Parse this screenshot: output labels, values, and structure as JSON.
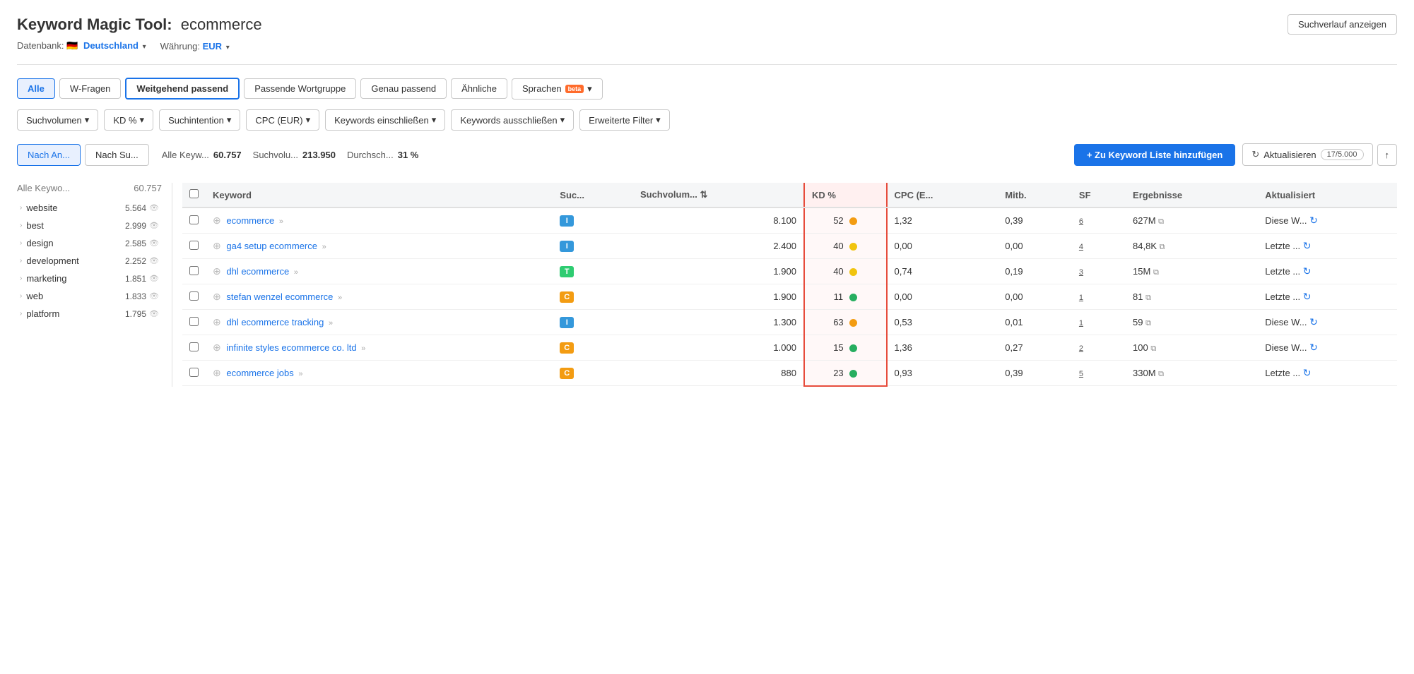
{
  "header": {
    "title_bold": "Keyword Magic Tool:",
    "title_query": "ecommerce",
    "suchverlauf_btn": "Suchverlauf anzeigen",
    "datenbank_label": "Datenbank:",
    "country": "Deutschland",
    "wahrung_label": "Währung:",
    "currency": "EUR"
  },
  "tabs": [
    {
      "id": "alle",
      "label": "Alle",
      "active": true,
      "highlighted": false
    },
    {
      "id": "w-fragen",
      "label": "W-Fragen",
      "active": false,
      "highlighted": false
    },
    {
      "id": "weitgehend",
      "label": "Weitgehend passend",
      "active": false,
      "highlighted": true
    },
    {
      "id": "passende",
      "label": "Passende Wortgruppe",
      "active": false,
      "highlighted": false
    },
    {
      "id": "genau",
      "label": "Genau passend",
      "active": false,
      "highlighted": false
    },
    {
      "id": "ahnliche",
      "label": "Ähnliche",
      "active": false,
      "highlighted": false
    },
    {
      "id": "sprachen",
      "label": "Sprachen",
      "active": false,
      "highlighted": false,
      "beta": true
    }
  ],
  "filters": [
    {
      "id": "suchvolumen",
      "label": "Suchvolumen ▾"
    },
    {
      "id": "kd",
      "label": "KD % ▾"
    },
    {
      "id": "suchintention",
      "label": "Suchintention ▾"
    },
    {
      "id": "cpc",
      "label": "CPC (EUR) ▾"
    },
    {
      "id": "einschliessen",
      "label": "Keywords einschließen ▾"
    },
    {
      "id": "ausschliessen",
      "label": "Keywords ausschließen ▾"
    },
    {
      "id": "erweitert",
      "label": "Erweiterte Filter ▾"
    }
  ],
  "stats": {
    "sort_by_an": "Nach An...",
    "sort_by_su": "Nach Su...",
    "alle_keywords_label": "Alle Keyw...",
    "alle_keywords_value": "60.757",
    "suchvolumen_label": "Suchvolu...",
    "suchvolumen_value": "213.950",
    "durchschnitt_label": "Durchsch...",
    "durchschnitt_value": "31 %",
    "add_btn": "+ Zu Keyword Liste hinzufügen",
    "aktualisieren_btn": "Aktualisieren",
    "limit": "17/5.000"
  },
  "left_panel": {
    "title": "Alle Keywo...",
    "count": "60.757",
    "items": [
      {
        "name": "website",
        "count": "5.564"
      },
      {
        "name": "best",
        "count": "2.999"
      },
      {
        "name": "design",
        "count": "2.585"
      },
      {
        "name": "development",
        "count": "2.252"
      },
      {
        "name": "marketing",
        "count": "1.851"
      },
      {
        "name": "web",
        "count": "1.833"
      },
      {
        "name": "platform",
        "count": "1.795"
      }
    ]
  },
  "table": {
    "columns": [
      {
        "id": "keyword",
        "label": "Keyword"
      },
      {
        "id": "suc",
        "label": "Suc..."
      },
      {
        "id": "suchvolumen",
        "label": "Suchvolum..."
      },
      {
        "id": "kd",
        "label": "KD %",
        "sorted": true
      },
      {
        "id": "cpc",
        "label": "CPC (E..."
      },
      {
        "id": "mitb",
        "label": "Mitb."
      },
      {
        "id": "sf",
        "label": "SF"
      },
      {
        "id": "ergebnisse",
        "label": "Ergebnisse"
      },
      {
        "id": "aktualisiert",
        "label": "Aktualisiert"
      }
    ],
    "rows": [
      {
        "keyword": "ecommerce",
        "arrows": "»",
        "intent": "I",
        "intent_type": "i",
        "suchvolumen": "8.100",
        "kd": "52",
        "kd_color": "orange",
        "cpc": "1,32",
        "mitb": "0,39",
        "sf": "6",
        "ergebnisse": "627M",
        "aktualisiert": "Diese W..."
      },
      {
        "keyword": "ga4 setup ecommerce",
        "arrows": "»",
        "intent": "I",
        "intent_type": "i",
        "suchvolumen": "2.400",
        "kd": "40",
        "kd_color": "yellow",
        "cpc": "0,00",
        "mitb": "0,00",
        "sf": "4",
        "ergebnisse": "84,8K",
        "aktualisiert": "Letzte ..."
      },
      {
        "keyword": "dhl ecommerce",
        "arrows": "»",
        "intent": "T",
        "intent_type": "t",
        "suchvolumen": "1.900",
        "kd": "40",
        "kd_color": "yellow",
        "cpc": "0,74",
        "mitb": "0,19",
        "sf": "3",
        "ergebnisse": "15M",
        "aktualisiert": "Letzte ..."
      },
      {
        "keyword": "stefan wenzel ecommerce",
        "arrows": "»",
        "intent": "C",
        "intent_type": "c",
        "suchvolumen": "1.900",
        "kd": "11",
        "kd_color": "green",
        "cpc": "0,00",
        "mitb": "0,00",
        "sf": "1",
        "ergebnisse": "81",
        "aktualisiert": "Letzte ..."
      },
      {
        "keyword": "dhl ecommerce tracking",
        "arrows": "»",
        "intent": "I",
        "intent_type": "i",
        "suchvolumen": "1.300",
        "kd": "63",
        "kd_color": "orange",
        "cpc": "0,53",
        "mitb": "0,01",
        "sf": "1",
        "ergebnisse": "59",
        "aktualisiert": "Diese W..."
      },
      {
        "keyword": "infinite styles ecommerce co. ltd",
        "arrows": "»",
        "intent": "C",
        "intent_type": "c",
        "suchvolumen": "1.000",
        "kd": "15",
        "kd_color": "green",
        "cpc": "1,36",
        "mitb": "0,27",
        "sf": "2",
        "ergebnisse": "100",
        "aktualisiert": "Diese W..."
      },
      {
        "keyword": "ecommerce jobs",
        "arrows": "»",
        "intent": "C",
        "intent_type": "c",
        "suchvolumen": "880",
        "kd": "23",
        "kd_color": "green",
        "cpc": "0,93",
        "mitb": "0,39",
        "sf": "5",
        "ergebnisse": "330M",
        "aktualisiert": "Letzte ..."
      }
    ]
  }
}
